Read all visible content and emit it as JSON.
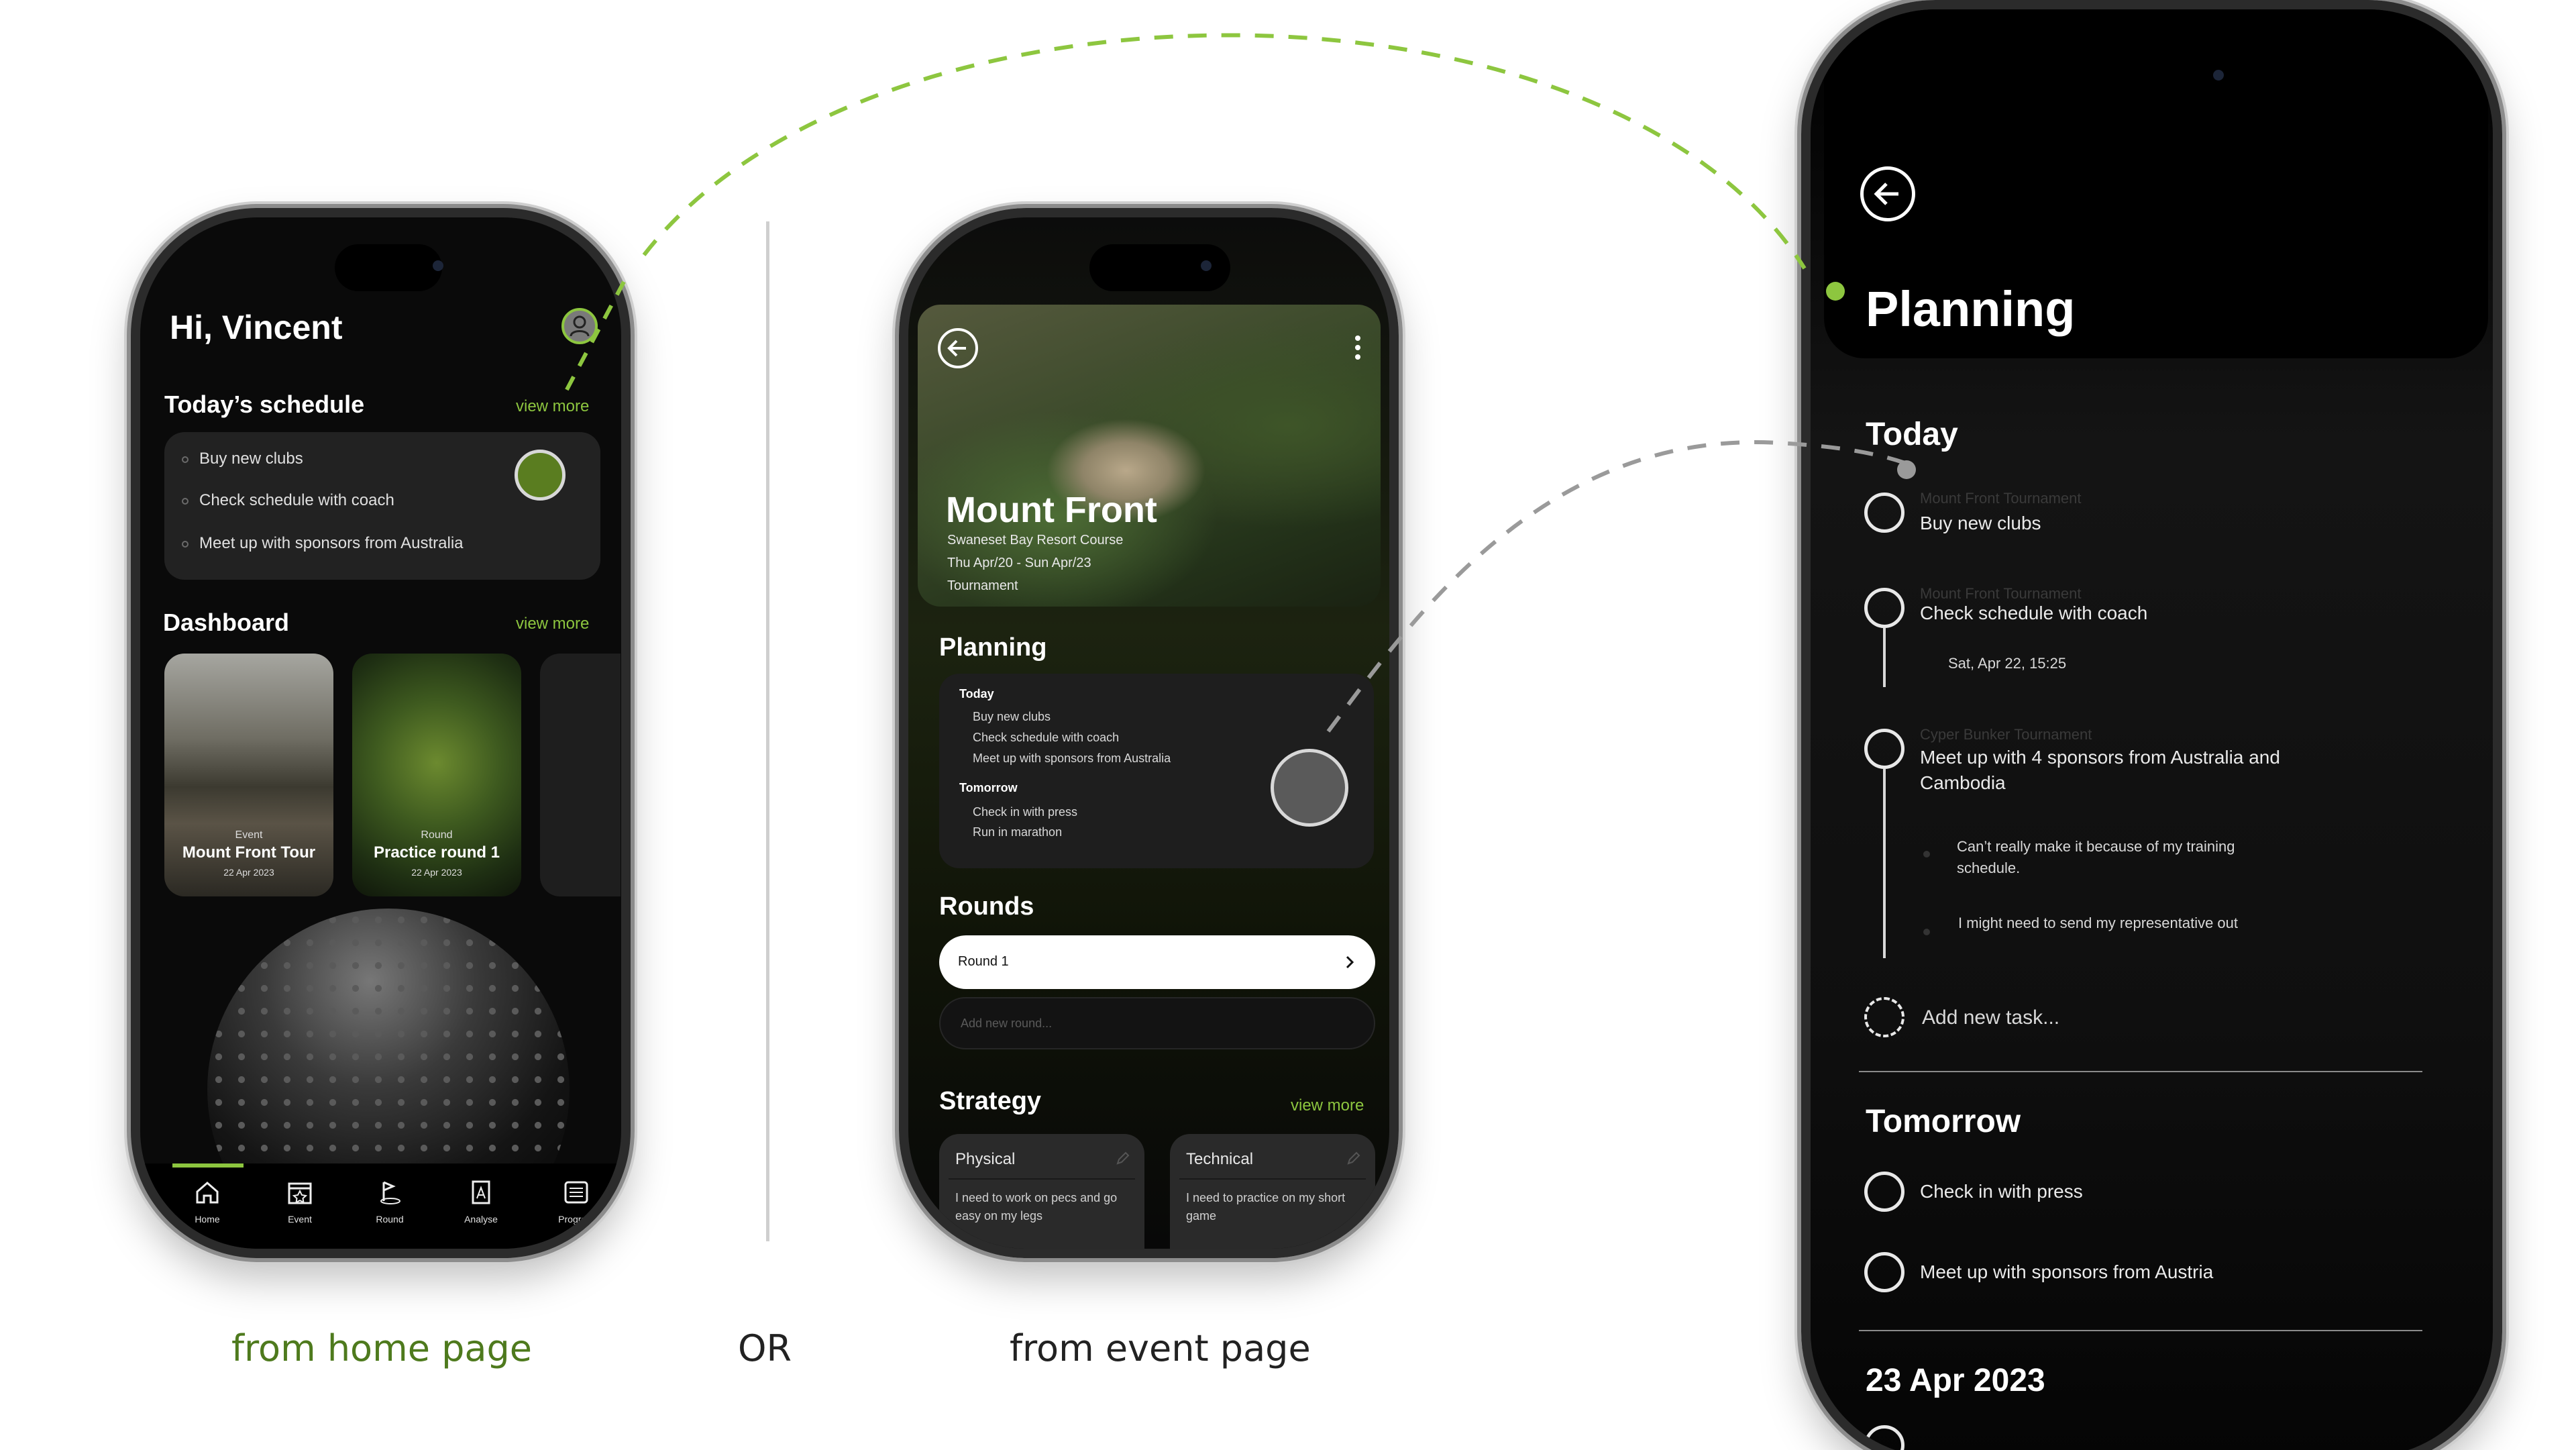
{
  "captions": {
    "home": "from home page",
    "or": "OR",
    "event": "from event page"
  },
  "colors": {
    "accent": "#8dc63f",
    "bg": "#000000",
    "card": "#222222"
  },
  "home": {
    "greeting": "Hi, Vincent",
    "schedule_title": "Today’s schedule",
    "schedule_view_more": "view more",
    "schedule_items": [
      "Buy new clubs",
      "Check schedule with coach",
      "Meet up with sponsors from Australia"
    ],
    "dashboard_title": "Dashboard",
    "dashboard_view_more": "view more",
    "cards": [
      {
        "type": "Event",
        "title": "Mount Front Tour",
        "date": "22 Apr 2023"
      },
      {
        "type": "Round",
        "title": "Practice round 1",
        "date": "22 Apr 2023"
      }
    ],
    "nav": [
      "Home",
      "Event",
      "Round",
      "Analyse",
      "Program"
    ],
    "nav_icons": [
      "home-icon",
      "calendar-star-icon",
      "golf-flag-icon",
      "analyse-report-icon",
      "program-list-icon"
    ]
  },
  "event": {
    "title": "Mount Front",
    "course": "Swaneset Bay Resort Course",
    "dates": "Thu Apr/20 - Sun Apr/23",
    "category": "Tournament",
    "planning_title": "Planning",
    "planning_today": "Today",
    "today_items": [
      "Buy new clubs",
      "Check schedule with coach",
      "Meet up with sponsors from Australia"
    ],
    "planning_tomorrow": "Tomorrow",
    "tomorrow_items": [
      "Check in with press",
      "Run in marathon"
    ],
    "rounds_title": "Rounds",
    "round_button": "Round 1",
    "add_round_placeholder": "Add new round...",
    "strategy_title": "Strategy",
    "strategy_view_more": "view more",
    "strategies": [
      {
        "title": "Physical",
        "text": "I need to work on pecs and go easy on my legs"
      },
      {
        "title": "Technical",
        "text": "I need to practice on my short game"
      }
    ]
  },
  "planning": {
    "title": "Planning",
    "today_heading": "Today",
    "today_tasks": [
      {
        "event": "Mount Front Tournament",
        "task": "Buy new clubs"
      },
      {
        "event": "Mount Front Tournament",
        "task": "Check schedule with coach",
        "sub": "Sat, Apr 22, 15:25"
      },
      {
        "event": "Cyper Bunker Tournament",
        "task": "Meet up with 4 sponsors from Australia and Cambodia",
        "notes": [
          "Can’t really make it because of my training schedule.",
          "I might need to send my representative out"
        ]
      }
    ],
    "add_task": "Add new task...",
    "tomorrow_heading": "Tomorrow",
    "tomorrow_tasks": [
      "Check in with press",
      "Meet up with sponsors from Austria"
    ],
    "date_heading": "23 Apr 2023"
  }
}
